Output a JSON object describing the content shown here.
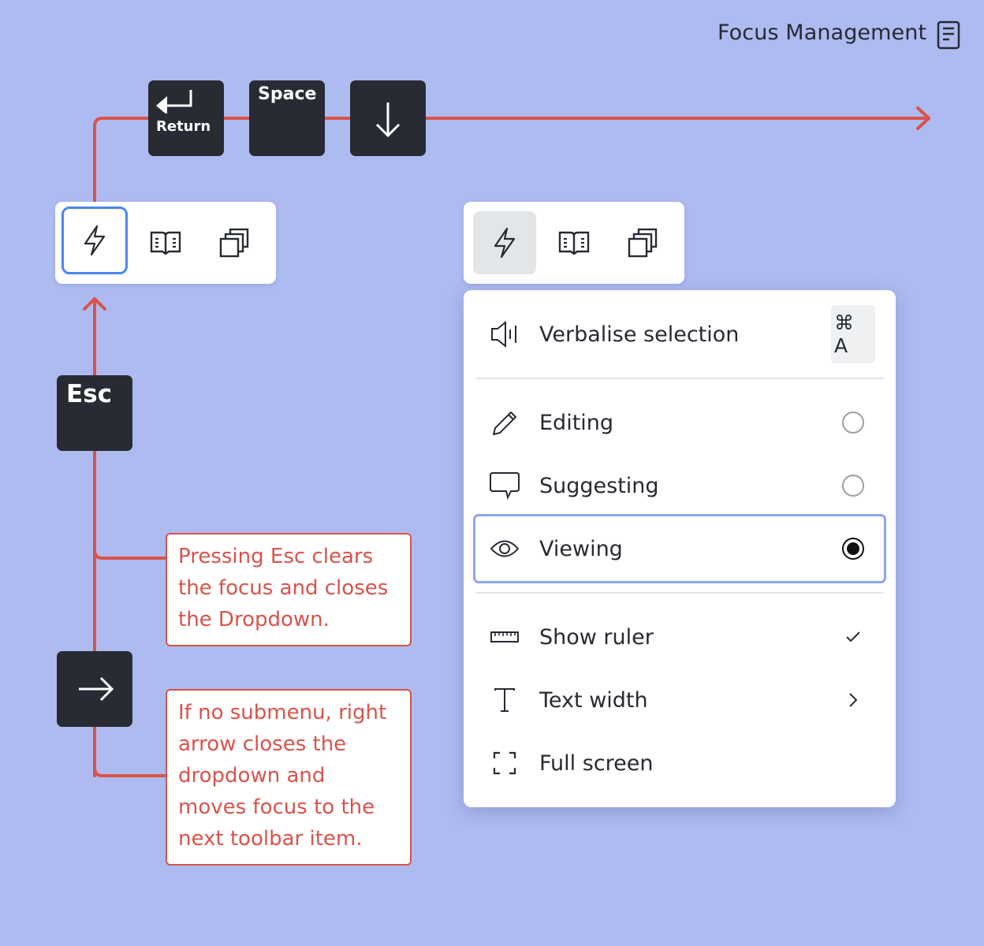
{
  "header": {
    "title": "Focus Management",
    "icon": "document-icon"
  },
  "colors": {
    "background": "#aebbf0",
    "flow_line": "#d9534a",
    "key_bg": "#282b33",
    "focus_ring": "#4a86f0",
    "menu_focus_ring": "#8fa6ef"
  },
  "keys": {
    "return": {
      "label": "Return",
      "icon": "return-arrow-icon"
    },
    "space": {
      "label": "Space"
    },
    "down": {
      "icon": "arrow-down-icon"
    },
    "esc": {
      "label": "Esc"
    },
    "right": {
      "icon": "arrow-right-icon"
    }
  },
  "toolbars": [
    {
      "state": "focused",
      "items": [
        {
          "icon": "lightning-icon",
          "state": "focused"
        },
        {
          "icon": "book-icon"
        },
        {
          "icon": "copy-icon"
        }
      ]
    },
    {
      "state": "open",
      "items": [
        {
          "icon": "lightning-icon",
          "state": "active"
        },
        {
          "icon": "book-icon"
        },
        {
          "icon": "copy-icon"
        }
      ]
    }
  ],
  "menu": {
    "items": [
      {
        "label": "Verbalise selection",
        "icon": "speaker-icon",
        "shortcut": "⌘ A"
      },
      {
        "label": "Editing",
        "icon": "pencil-icon",
        "type": "radio",
        "checked": false
      },
      {
        "label": "Suggesting",
        "icon": "comment-icon",
        "type": "radio",
        "checked": false
      },
      {
        "label": "Viewing",
        "icon": "eye-icon",
        "type": "radio",
        "checked": true,
        "focused": true
      },
      {
        "label": "Show ruler",
        "icon": "ruler-icon",
        "type": "check",
        "checked": true
      },
      {
        "label": "Text width",
        "icon": "text-icon",
        "type": "submenu"
      },
      {
        "label": "Full screen",
        "icon": "fullscreen-icon"
      }
    ]
  },
  "notes": {
    "esc": "Pressing Esc clears the focus and closes the Dropdown.",
    "right": "If no submenu, right arrow closes the dropdown and moves focus to the next toolbar item."
  }
}
